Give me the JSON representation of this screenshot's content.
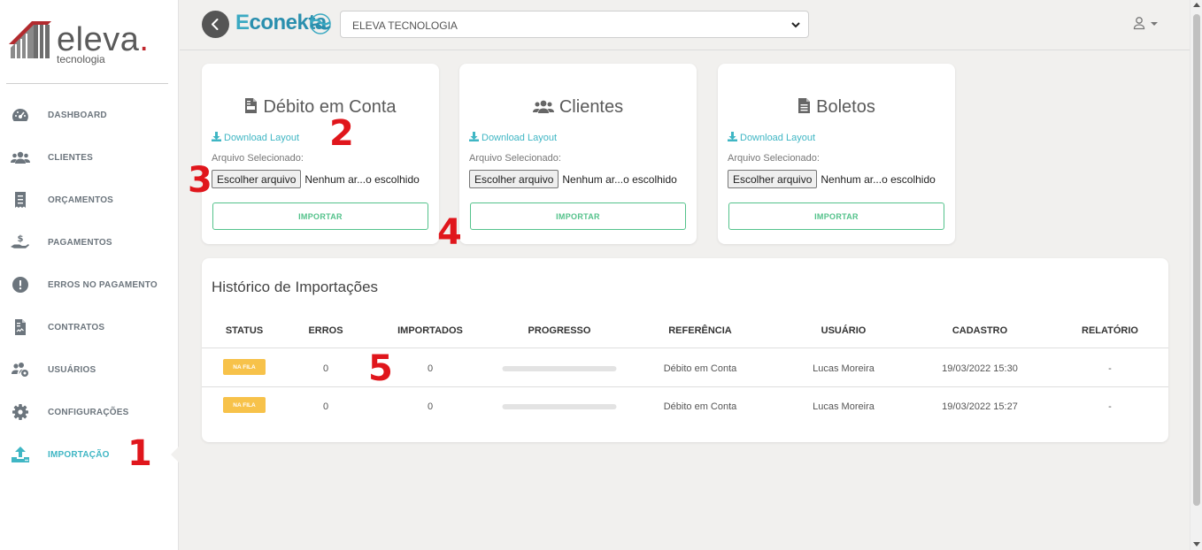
{
  "brand": {
    "logo_main": "eleva",
    "logo_dot": ".",
    "logo_sub": "tecnologia",
    "app_name_first": "E",
    "app_name_rest": "conekta"
  },
  "sidebar": {
    "items": [
      {
        "label": "DASHBOARD",
        "icon": "gauge-icon"
      },
      {
        "label": "CLIENTES",
        "icon": "users-icon"
      },
      {
        "label": "ORÇAMENTOS",
        "icon": "receipt-icon"
      },
      {
        "label": "PAGAMENTOS",
        "icon": "hand-dollar-icon"
      },
      {
        "label": "ERROS NO PAGAMENTO",
        "icon": "exclamation-circle-icon"
      },
      {
        "label": "CONTRATOS",
        "icon": "file-contract-icon"
      },
      {
        "label": "USUÁRIOS",
        "icon": "users-cog-icon"
      },
      {
        "label": "CONFIGURAÇÕES",
        "icon": "gear-icon"
      },
      {
        "label": "IMPORTAÇÃO",
        "icon": "upload-icon",
        "active": true
      }
    ]
  },
  "topbar": {
    "company_selected": "ELEVA TECNOLOGIA"
  },
  "annotations": [
    "1",
    "2",
    "3",
    "4",
    "5"
  ],
  "cards": [
    {
      "title": "Débito em Conta",
      "icon": "file-invoice-icon",
      "download_label": "Download Layout",
      "selected_label": "Arquivo Selecionado:",
      "file_button": "Escolher arquivo",
      "file_none": "Nenhum ar...o escolhido",
      "import_label": "IMPORTAR"
    },
    {
      "title": "Clientes",
      "icon": "users-icon",
      "download_label": "Download Layout",
      "selected_label": "Arquivo Selecionado:",
      "file_button": "Escolher arquivo",
      "file_none": "Nenhum ar...o escolhido",
      "import_label": "IMPORTAR"
    },
    {
      "title": "Boletos",
      "icon": "file-alt-icon",
      "download_label": "Download Layout",
      "selected_label": "Arquivo Selecionado:",
      "file_button": "Escolher arquivo",
      "file_none": "Nenhum ar...o escolhido",
      "import_label": "IMPORTAR"
    }
  ],
  "history": {
    "title": "Histórico de Importações",
    "columns": [
      "STATUS",
      "ERROS",
      "IMPORTADOS",
      "PROGRESSO",
      "REFERÊNCIA",
      "USUÁRIO",
      "CADASTRO",
      "RELATÓRIO"
    ],
    "rows": [
      {
        "status": "NA FILA",
        "erros": "0",
        "importados": "0",
        "progress": 0,
        "referencia": "Débito em Conta",
        "usuario": "Lucas Moreira",
        "cadastro": "19/03/2022 15:30",
        "relatorio": "-"
      },
      {
        "status": "NA FILA",
        "erros": "0",
        "importados": "0",
        "progress": 0,
        "referencia": "Débito em Conta",
        "usuario": "Lucas Moreira",
        "cadastro": "19/03/2022 15:27",
        "relatorio": "-"
      }
    ]
  },
  "colors": {
    "accent": "#3fb6c4",
    "success": "#54c28b",
    "warning": "#f7c24a",
    "annotation": "#e0161c",
    "logo_red": "#c0272d"
  }
}
